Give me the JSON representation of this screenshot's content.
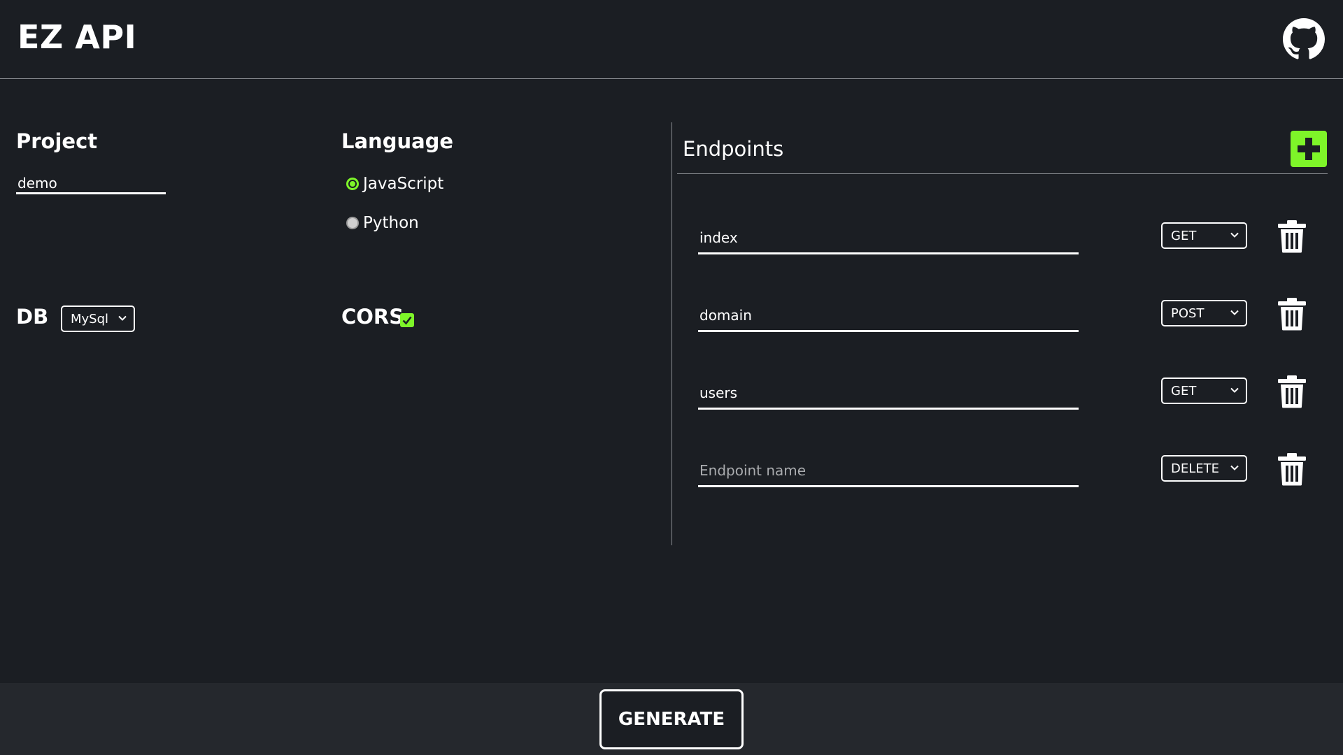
{
  "header": {
    "title": "EZ API",
    "github_icon": "github-icon"
  },
  "project": {
    "label": "Project",
    "value": "demo"
  },
  "language": {
    "label": "Language",
    "options": [
      {
        "label": "JavaScript",
        "selected": true
      },
      {
        "label": "Python",
        "selected": false
      }
    ]
  },
  "db": {
    "label": "DB",
    "selected": "MySql"
  },
  "cors": {
    "label": "CORS",
    "checked": true
  },
  "endpoints": {
    "title": "Endpoints",
    "add_icon": "plus-icon",
    "items": [
      {
        "name": "index",
        "placeholder": "Endpoint name",
        "method": "GET"
      },
      {
        "name": "domain",
        "placeholder": "Endpoint name",
        "method": "POST"
      },
      {
        "name": "users",
        "placeholder": "Endpoint name",
        "method": "GET"
      },
      {
        "name": "",
        "placeholder": "Endpoint name",
        "method": "DELETE"
      }
    ]
  },
  "footer": {
    "generate_label": "GENERATE"
  },
  "colors": {
    "background": "#1b1e23",
    "footer": "#25282d",
    "accent": "#7ef529",
    "divider": "#8a8d92"
  }
}
